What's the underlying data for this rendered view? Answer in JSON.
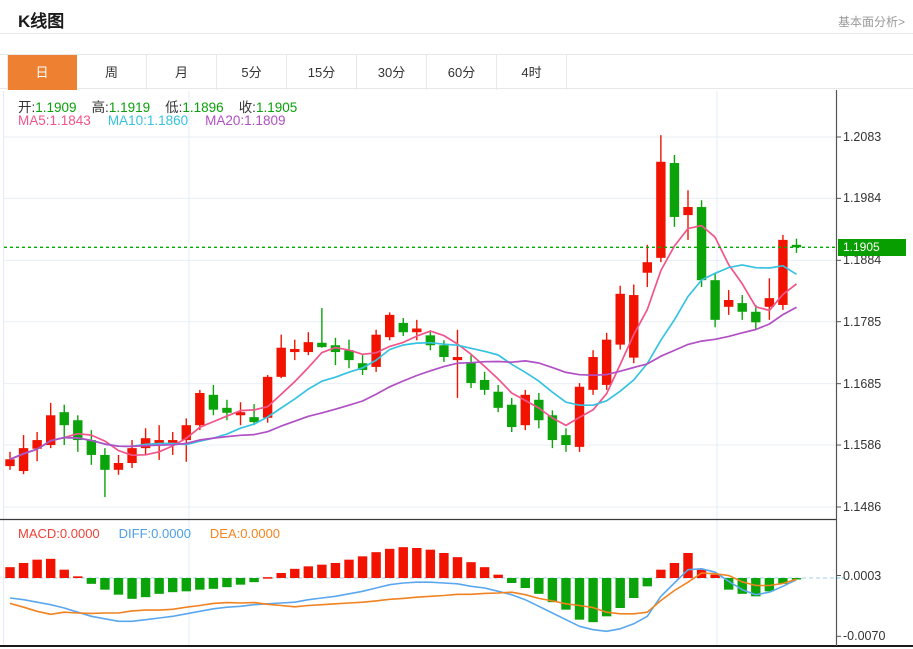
{
  "header": {
    "title": "K线图",
    "link_label": "基本面分析>"
  },
  "tabs": [
    {
      "id": "day",
      "label": "日",
      "active": true
    },
    {
      "id": "week",
      "label": "周",
      "active": false
    },
    {
      "id": "month",
      "label": "月",
      "active": false
    },
    {
      "id": "min5",
      "label": "5分",
      "active": false
    },
    {
      "id": "min15",
      "label": "15分",
      "active": false
    },
    {
      "id": "min30",
      "label": "30分",
      "active": false
    },
    {
      "id": "min60",
      "label": "60分",
      "active": false
    },
    {
      "id": "hour4",
      "label": "4时",
      "active": false
    }
  ],
  "legend_ohlc": [
    {
      "label": "开:",
      "value": "1.1909"
    },
    {
      "label": "高:",
      "value": "1.1919"
    },
    {
      "label": "低:",
      "value": "1.1896"
    },
    {
      "label": "收:",
      "value": "1.1905"
    }
  ],
  "legend_ma": [
    {
      "label": "MA5:",
      "value": "1.1843",
      "color": "#f0548b"
    },
    {
      "label": "MA10:",
      "value": "1.1860",
      "color": "#36c2e1"
    },
    {
      "label": "MA20:",
      "value": "1.1809",
      "color": "#b14fc5"
    }
  ],
  "legend_macd": [
    {
      "label": "MACD:",
      "value": "0.0000",
      "color": "#ef4238"
    },
    {
      "label": "DIFF:",
      "value": "0.0000",
      "color": "#4d9fe8"
    },
    {
      "label": "DEA:",
      "value": "0.0000",
      "color": "#f5851f"
    }
  ],
  "price_axis": {
    "ticks": [
      1.2083,
      1.1984,
      1.1884,
      1.1785,
      1.1685,
      1.1586,
      1.1486
    ],
    "current_label": "1.1905"
  },
  "macd_axis": {
    "ticks": [
      0.0003,
      -0.007
    ]
  },
  "colors": {
    "up": "#f11300",
    "down": "#0aa40a",
    "tag_bg": "#089e00",
    "tab_active": "#ee8131",
    "ohlc_value": "#0aa00a",
    "ma5": "#f0548b",
    "ma10": "#36c2e1",
    "ma20": "#b14fc5",
    "diff_line": "#5aa7ee",
    "dea_line": "#f08221",
    "dotted_price": "#00aa00",
    "grid": "#e9eff6",
    "grid_vertical": "#e3ecf4",
    "axis": "#555"
  },
  "chart_data": {
    "type": "candlestick",
    "title": "K线图",
    "y_axis": {
      "ticks": [
        1.2083,
        1.1984,
        1.1884,
        1.1785,
        1.1685,
        1.1586,
        1.1486
      ],
      "current_price": 1.1905
    },
    "ma_periods": [
      5,
      10,
      20
    ],
    "last_bar": {
      "open": 1.1909,
      "high": 1.1919,
      "low": 1.1896,
      "close": 1.1905
    },
    "candles": [
      [
        1.1552,
        1.1575,
        1.1546,
        1.1563
      ],
      [
        1.1544,
        1.1602,
        1.1539,
        1.1581
      ],
      [
        1.158,
        1.1607,
        1.156,
        1.1594
      ],
      [
        1.1586,
        1.1654,
        1.1581,
        1.1634
      ],
      [
        1.1639,
        1.1651,
        1.1586,
        1.1618
      ],
      [
        1.1626,
        1.1634,
        1.1575,
        1.1594
      ],
      [
        1.1594,
        1.161,
        1.1554,
        1.157
      ],
      [
        1.157,
        1.1581,
        1.1502,
        1.1546
      ],
      [
        1.1546,
        1.157,
        1.1538,
        1.1557
      ],
      [
        1.1557,
        1.1594,
        1.1549,
        1.1581
      ],
      [
        1.1581,
        1.1613,
        1.157,
        1.1597
      ],
      [
        1.1589,
        1.1618,
        1.1562,
        1.1594
      ],
      [
        1.1588,
        1.1607,
        1.157,
        1.1594
      ],
      [
        1.1594,
        1.1629,
        1.1559,
        1.1618
      ],
      [
        1.1618,
        1.1675,
        1.161,
        1.167
      ],
      [
        1.1667,
        1.1683,
        1.1634,
        1.1643
      ],
      [
        1.1646,
        1.1659,
        1.1626,
        1.1638
      ],
      [
        1.1634,
        1.1655,
        1.1618,
        1.1639
      ],
      [
        1.1631,
        1.1652,
        1.1618,
        1.1623
      ],
      [
        1.163,
        1.1699,
        1.1622,
        1.1696
      ],
      [
        1.1696,
        1.1764,
        1.1694,
        1.1743
      ],
      [
        1.1736,
        1.1756,
        1.1723,
        1.1741
      ],
      [
        1.1736,
        1.1768,
        1.1731,
        1.1752
      ],
      [
        1.1751,
        1.1807,
        1.1743,
        1.1744
      ],
      [
        1.1747,
        1.1759,
        1.1715,
        1.1736
      ],
      [
        1.1739,
        1.1756,
        1.171,
        1.1723
      ],
      [
        1.1718,
        1.1731,
        1.1699,
        1.1707
      ],
      [
        1.1712,
        1.1772,
        1.1704,
        1.1764
      ],
      [
        1.176,
        1.18,
        1.1755,
        1.1796
      ],
      [
        1.1783,
        1.1791,
        1.1762,
        1.1768
      ],
      [
        1.1768,
        1.1788,
        1.1755,
        1.1774
      ],
      [
        1.1763,
        1.1771,
        1.1739,
        1.1747
      ],
      [
        1.1747,
        1.1755,
        1.172,
        1.1728
      ],
      [
        1.1723,
        1.1772,
        1.1662,
        1.1728
      ],
      [
        1.172,
        1.1731,
        1.1678,
        1.1686
      ],
      [
        1.1691,
        1.1704,
        1.1667,
        1.1675
      ],
      [
        1.1672,
        1.1683,
        1.1639,
        1.1646
      ],
      [
        1.1651,
        1.1662,
        1.1607,
        1.1615
      ],
      [
        1.1618,
        1.1675,
        1.161,
        1.1667
      ],
      [
        1.1659,
        1.167,
        1.1613,
        1.1626
      ],
      [
        1.1634,
        1.1642,
        1.1581,
        1.1594
      ],
      [
        1.1602,
        1.1613,
        1.1575,
        1.1586
      ],
      [
        1.1583,
        1.1686,
        1.1575,
        1.168
      ],
      [
        1.1675,
        1.1739,
        1.1667,
        1.1728
      ],
      [
        1.1683,
        1.1767,
        1.1675,
        1.1756
      ],
      [
        1.1748,
        1.1843,
        1.174,
        1.183
      ],
      [
        1.1727,
        1.1845,
        1.1718,
        1.1828
      ],
      [
        1.1864,
        1.1909,
        1.1841,
        1.1881
      ],
      [
        1.1888,
        1.2086,
        1.1881,
        1.2043
      ],
      [
        1.2041,
        1.2054,
        1.1938,
        1.1954
      ],
      [
        1.1957,
        1.1997,
        1.1917,
        1.197
      ],
      [
        1.197,
        1.1981,
        1.1841,
        1.1852
      ],
      [
        1.1852,
        1.1864,
        1.1776,
        1.1788
      ],
      [
        1.1809,
        1.1836,
        1.1796,
        1.182
      ],
      [
        1.1815,
        1.1828,
        1.1788,
        1.1801
      ],
      [
        1.1801,
        1.1812,
        1.1772,
        1.1784
      ],
      [
        1.1809,
        1.1855,
        1.1788,
        1.1823
      ],
      [
        1.1812,
        1.1925,
        1.1804,
        1.1917
      ],
      [
        1.1909,
        1.1919,
        1.1896,
        1.1905
      ]
    ],
    "macd": {
      "y_ticks": [
        0.0003,
        -0.007
      ],
      "hist": [
        0.0013,
        0.0018,
        0.0022,
        0.0023,
        0.001,
        0.0002,
        -0.0007,
        -0.0014,
        -0.002,
        -0.0025,
        -0.0023,
        -0.0019,
        -0.0017,
        -0.0016,
        -0.0014,
        -0.0013,
        -0.0011,
        -0.0008,
        -0.0005,
        0.0001,
        0.0006,
        0.0011,
        0.0014,
        0.0016,
        0.0018,
        0.0022,
        0.0026,
        0.0031,
        0.0035,
        0.0037,
        0.0036,
        0.0034,
        0.003,
        0.0025,
        0.0019,
        0.0013,
        0.0004,
        -0.0006,
        -0.0012,
        -0.0019,
        -0.0029,
        -0.0038,
        -0.005,
        -0.0053,
        -0.0046,
        -0.0036,
        -0.0024,
        -0.001,
        0.001,
        0.0018,
        0.003,
        0.001,
        0.0004,
        -0.0014,
        -0.0019,
        -0.0022,
        -0.0016,
        -0.0007,
        -0.0001
      ],
      "diff": [
        -0.0024,
        -0.0026,
        -0.0029,
        -0.0032,
        -0.0036,
        -0.0041,
        -0.0046,
        -0.0049,
        -0.0052,
        -0.0052,
        -0.005,
        -0.0048,
        -0.0046,
        -0.0043,
        -0.004,
        -0.0037,
        -0.0035,
        -0.0034,
        -0.0032,
        -0.0031,
        -0.003,
        -0.0029,
        -0.0026,
        -0.0024,
        -0.0022,
        -0.0019,
        -0.0016,
        -0.0012,
        -0.0008,
        -0.0006,
        -0.0005,
        -0.0005,
        -0.0006,
        -0.0007,
        -0.001,
        -0.0012,
        -0.0016,
        -0.002,
        -0.0026,
        -0.0034,
        -0.0042,
        -0.005,
        -0.0058,
        -0.0062,
        -0.0064,
        -0.0061,
        -0.0055,
        -0.0046,
        -0.0022,
        -0.0006,
        0.001,
        0.0011,
        0.0007,
        -0.0004,
        -0.0014,
        -0.002,
        -0.0017,
        -0.001,
        -0.0002
      ]
    }
  }
}
